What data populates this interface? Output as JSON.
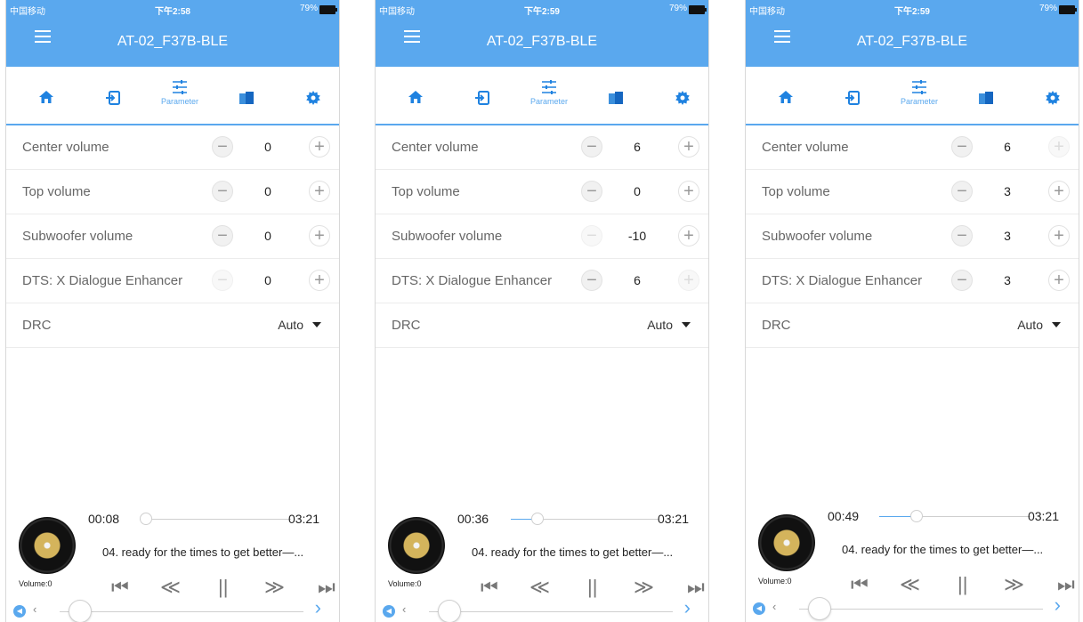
{
  "status": {
    "carrier": "中国移动",
    "battery": "79%"
  },
  "app": {
    "title": "AT-02_F37B-BLE"
  },
  "tabs": [
    {
      "icon": "home-icon"
    },
    {
      "icon": "input-icon"
    },
    {
      "icon": "parameter-icon",
      "label": "Parameter",
      "active": true
    },
    {
      "icon": "layers-icon"
    },
    {
      "icon": "gear-icon"
    }
  ],
  "labels": {
    "center": "Center volume",
    "top": "Top volume",
    "sub": "Subwoofer volume",
    "dts": "DTS: X Dialogue Enhancer",
    "drc": "DRC"
  },
  "colors": {
    "accent": "#5aa8ee"
  },
  "screens": [
    {
      "time": "下午2:58",
      "values": {
        "center": "0",
        "top": "0",
        "sub": "0",
        "dts": "0"
      },
      "drc": "Auto",
      "player": {
        "elapsed": "00:08",
        "total": "03:21",
        "progress": 0.04,
        "track": "04.  ready for the times to get better—...",
        "volume": "Volume:0"
      }
    },
    {
      "time": "下午2:59",
      "values": {
        "center": "6",
        "top": "0",
        "sub": "-10",
        "dts": "6"
      },
      "drc": "Auto",
      "player": {
        "elapsed": "00:36",
        "total": "03:21",
        "progress": 0.18,
        "track": "04.  ready for the times to get better—...",
        "volume": "Volume:0"
      }
    },
    {
      "time": "下午2:59",
      "values": {
        "center": "6",
        "top": "3",
        "sub": "3",
        "dts": "3"
      },
      "drc": "Auto",
      "player": {
        "elapsed": "00:49",
        "total": "03:21",
        "progress": 0.24,
        "track": "04.  ready for the times to get better—...",
        "volume": "Volume:0"
      }
    }
  ]
}
